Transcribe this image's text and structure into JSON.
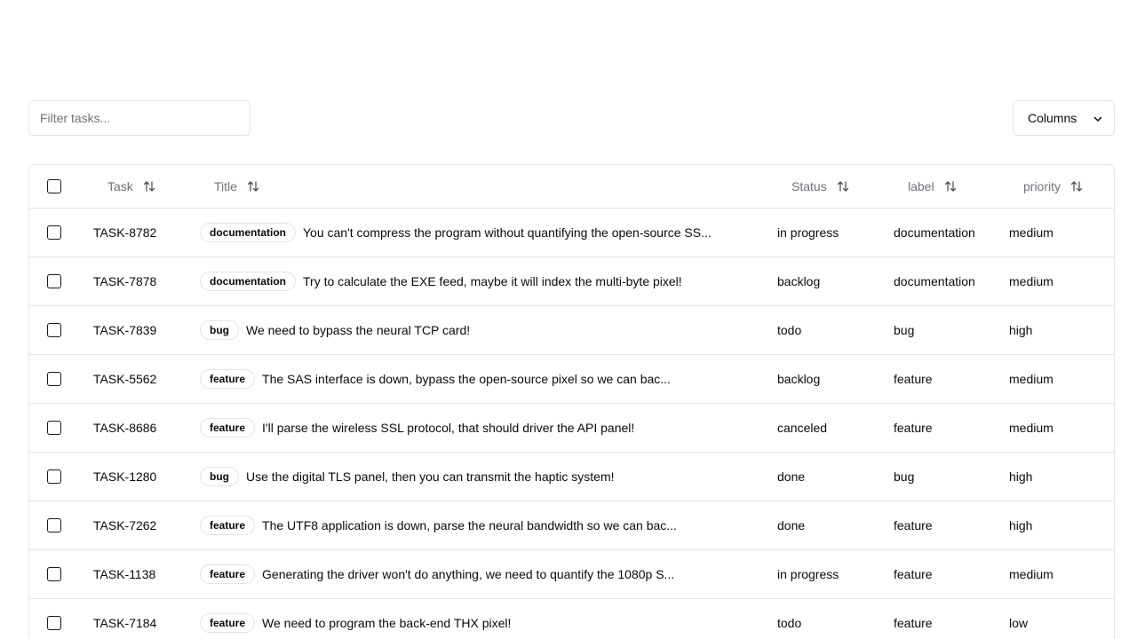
{
  "filter": {
    "placeholder": "Filter tasks..."
  },
  "columns_button": {
    "label": "Columns"
  },
  "headers": {
    "task": "Task",
    "title": "Title",
    "status": "Status",
    "label": "label",
    "priority": "priority"
  },
  "rows": [
    {
      "id": "TASK-8782",
      "badge": "documentation",
      "title": "You can't compress the program without quantifying the open-source SS...",
      "status": "in progress",
      "label": "documentation",
      "priority": "medium"
    },
    {
      "id": "TASK-7878",
      "badge": "documentation",
      "title": "Try to calculate the EXE feed, maybe it will index the multi-byte pixel!",
      "status": "backlog",
      "label": "documentation",
      "priority": "medium"
    },
    {
      "id": "TASK-7839",
      "badge": "bug",
      "title": "We need to bypass the neural TCP card!",
      "status": "todo",
      "label": "bug",
      "priority": "high"
    },
    {
      "id": "TASK-5562",
      "badge": "feature",
      "title": "The SAS interface is down, bypass the open-source pixel so we can bac...",
      "status": "backlog",
      "label": "feature",
      "priority": "medium"
    },
    {
      "id": "TASK-8686",
      "badge": "feature",
      "title": "I'll parse the wireless SSL protocol, that should driver the API panel!",
      "status": "canceled",
      "label": "feature",
      "priority": "medium"
    },
    {
      "id": "TASK-1280",
      "badge": "bug",
      "title": "Use the digital TLS panel, then you can transmit the haptic system!",
      "status": "done",
      "label": "bug",
      "priority": "high"
    },
    {
      "id": "TASK-7262",
      "badge": "feature",
      "title": "The UTF8 application is down, parse the neural bandwidth so we can bac...",
      "status": "done",
      "label": "feature",
      "priority": "high"
    },
    {
      "id": "TASK-1138",
      "badge": "feature",
      "title": "Generating the driver won't do anything, we need to quantify the 1080p S...",
      "status": "in progress",
      "label": "feature",
      "priority": "medium"
    },
    {
      "id": "TASK-7184",
      "badge": "feature",
      "title": "We need to program the back-end THX pixel!",
      "status": "todo",
      "label": "feature",
      "priority": "low"
    }
  ]
}
